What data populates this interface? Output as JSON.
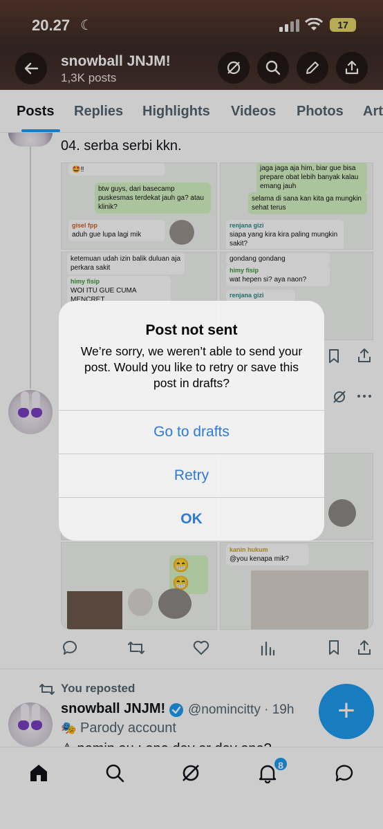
{
  "status_bar": {
    "time": "20.27",
    "battery": "17"
  },
  "header": {
    "title": "snowball JNJM!",
    "subtitle": "1,3K posts"
  },
  "tabs": [
    "Posts",
    "Replies",
    "Highlights",
    "Videos",
    "Photos",
    "Art"
  ],
  "tweet1": {
    "text": "04. serba serbi kkn.",
    "chat_left_top": [
      {
        "type": "out",
        "text": "btw guys, dari basecamp puskesmas terdekat jauh ga? atau klinik?",
        "time": "18.58"
      },
      {
        "type": "in",
        "who": "gisel fpp",
        "text": "aduh gue lupa lagi mik",
        "time": "18.59"
      }
    ],
    "chat_right_top": [
      {
        "type": "out",
        "text": "jaga jaga aja him, biar gue bisa prepare obat lebih banyak kalau emang jauh",
        "time": "19.06"
      },
      {
        "type": "out",
        "text": "selama di sana kan kita ga mungkin sehat terus",
        "time": "19.06"
      },
      {
        "type": "in",
        "who": "renjana gizi",
        "text": "siapa yang kira kira paling mungkin sakit?",
        "time": "19.07"
      }
    ],
    "chat_left_mid": [
      {
        "type": "in",
        "who": "",
        "text": "ketemuan udah izin balik duluan aja perkara sakit",
        "time": "19.08"
      },
      {
        "type": "in",
        "who": "himy fisip",
        "text": "WOI ITU GUE CUMA MENCRET",
        "time": "19.09"
      }
    ],
    "chat_right_mid": [
      {
        "type": "in",
        "who": "",
        "text": "gondang gondang",
        "time": "19.14"
      },
      {
        "type": "in",
        "who": "himy fisip",
        "text": "wat hepen si? aya naon?",
        "time": "19.14"
      },
      {
        "type": "in",
        "who": "renjana gizi",
        "text": "",
        "time": ""
      }
    ]
  },
  "tweet2": {
    "chat_left": [
      {
        "type": "out",
        "text": "😁😁",
        "time": "19.29"
      }
    ],
    "chat_right": [
      {
        "type": "in",
        "who": "kanin hukum",
        "text": "@you kenapa mik?",
        "time": "19.32"
      }
    ]
  },
  "alert": {
    "title": "Post not sent",
    "message": "We’re sorry, we weren’t able to send your post. Would you like to retry or save this post in drafts?",
    "buttons": [
      "Go to drafts",
      "Retry",
      "OK"
    ]
  },
  "tweet3": {
    "reposted_label": "You reposted",
    "name": "snowball JNJM!",
    "handle": "@nomincitty · 19h",
    "parody_label": "Parody account",
    "partial_text": "⚠ nomin au : one day or day one?"
  },
  "bottom_nav": {
    "notification_count": "8"
  },
  "colors": {
    "accent": "#1d9bf0",
    "alert_button": "#2f7ad6",
    "header_bg": "#4a3430"
  }
}
